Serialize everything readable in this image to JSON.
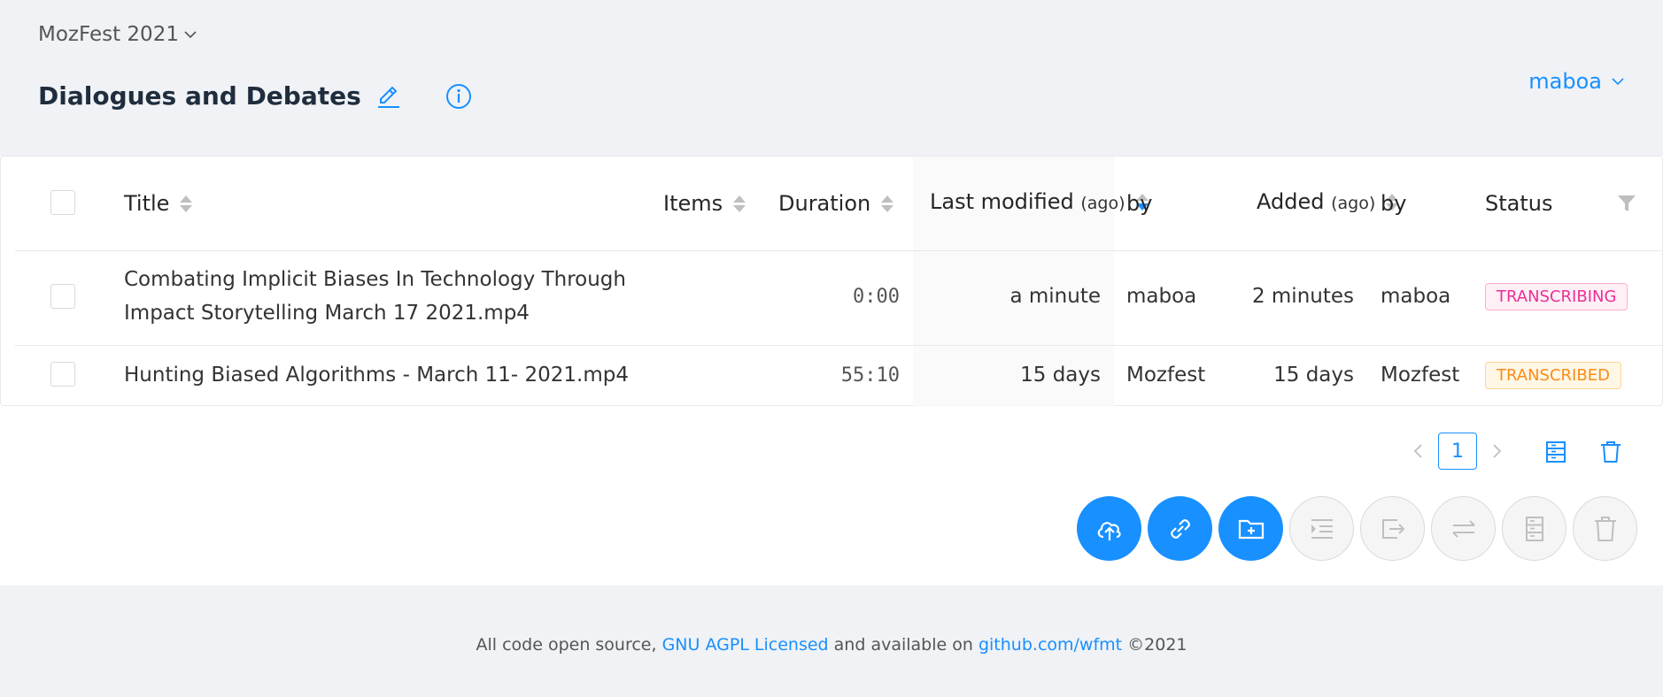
{
  "header": {
    "project": "MozFest 2021",
    "title": "Dialogues and Debates",
    "user": "maboa"
  },
  "table": {
    "columns": {
      "title": "Title",
      "items": "Items",
      "duration": "Duration",
      "last_modified": "Last modified",
      "last_modified_sub": "(ago)",
      "modified_by": "by",
      "added": "Added",
      "added_sub": "(ago)",
      "added_by": "by",
      "status": "Status"
    },
    "rows": [
      {
        "title_line1": "Combating Implicit Biases In Technology Through",
        "title_line2": "Impact Storytelling March 17 2021.mp4",
        "items": "",
        "duration": "0:00",
        "last_modified": "a minute",
        "modified_by": "maboa",
        "added": "2 minutes",
        "added_by": "maboa",
        "status": "TRANSCRIBING"
      },
      {
        "title_line1": "Hunting Biased Algorithms - March 11- 2021.mp4",
        "title_line2": "",
        "items": "",
        "duration": "55:10",
        "last_modified": "15 days",
        "modified_by": "Mozfest",
        "added": "15 days",
        "added_by": "Mozfest",
        "status": "TRANSCRIBED"
      }
    ]
  },
  "pagination": {
    "current_page": "1"
  },
  "footer": {
    "text_before": "All code open source, ",
    "license_link": "GNU AGPL Licensed",
    "text_middle": " and available on ",
    "repo_link": "github.com/wfmt",
    "text_after": " ©2021"
  },
  "colors": {
    "accent": "#1890ff",
    "transcribing": "#eb2f96",
    "transcribed": "#fa8c16"
  },
  "icons": {
    "edit": "pencil-icon",
    "info": "info-icon",
    "upload": "cloud-upload-icon",
    "link": "link-icon",
    "new_folder": "folder-add-icon",
    "indent": "indent-icon",
    "export": "export-icon",
    "swap": "swap-icon",
    "archive": "archive-icon",
    "delete": "trash-icon"
  }
}
